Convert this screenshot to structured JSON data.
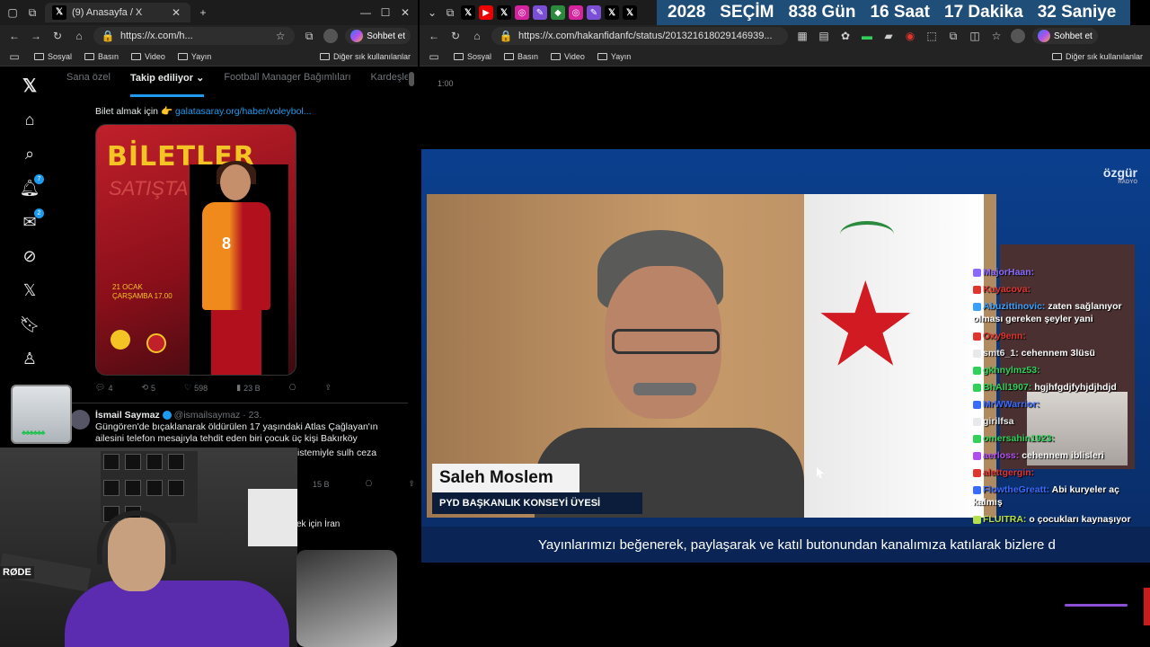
{
  "left_window": {
    "tab_title": "(9) Anasayfa / X",
    "url": "https://x.com/h...",
    "copilot_label": "Sohbet et",
    "bookmarks": [
      "Sosyal",
      "Basın",
      "Video",
      "Yayın"
    ],
    "bookmarks_right": "Diğer sık kullanılanlar"
  },
  "x_tabs": [
    "Sana özel",
    "Takip ediliyor",
    "Football Manager Bağımlıları",
    "Kardeşler Kı"
  ],
  "x_badges": {
    "notifications": "7",
    "messages": "2"
  },
  "tweet1": {
    "text_prefix": "Bilet almak için 👉",
    "link": "galatasaray.org/haber/voleybol...",
    "poster_title": "BİLETLER",
    "poster_subtitle": "SATIŞTA",
    "poster_date": "21 OCAK ÇARŞAMBA 17.00",
    "poster_number": "8",
    "replies": "4",
    "reposts": "5",
    "likes": "598",
    "views": "23 B"
  },
  "tweet2": {
    "name": "İsmail Saymaz",
    "handle": "@ismailsaymaz · 23.",
    "text": "Güngören'de bıçaklanarak öldürülen 17 yaşındaki Atlas Çağlayan'ın ailesini telefon mesajıyla tehdit eden biri çocuk üç kişi Bakırköy",
    "text_tail": "istemiyle sulh ceza",
    "views": "15 B"
  },
  "tweet3_fragment": "ek için İran",
  "webcam_brand": "RØDE",
  "right_window": {
    "url": "https://x.com/hakanfidanfc/status/2013216180291469​39...",
    "copilot_label": "Sohbet et",
    "bookmarks": [
      "Sosyal",
      "Basın",
      "Video",
      "Yayın"
    ],
    "bookmarks_right": "Diğer sık kullanılanlar"
  },
  "countdown": {
    "year": "2028",
    "label": "SEÇİM",
    "days": "838 Gün",
    "hours": "16 Saat",
    "minutes": "17 Dakika",
    "seconds": "32 Saniye"
  },
  "video": {
    "time": "1:00",
    "channel_logo": "özgür",
    "channel_sub": "RADYO",
    "lower_name": "Saleh Moslem",
    "lower_title": "PYD BAŞKANLIK KONSEYİ ÜYESİ",
    "ticker": "Yayınlarımızı beğenerek, paylaşarak ve katıl butonundan kanalımıza katılarak bizlere d"
  },
  "chat": [
    {
      "user": "MajorHaan:",
      "msg": "",
      "color": "#8a6bff"
    },
    {
      "user": "Kuyacova:",
      "msg": "",
      "color": "#e0342f"
    },
    {
      "user": "Abuzittinovic:",
      "msg": "zaten sağlanıyor olması gereken şeyler yani",
      "color": "#3aa0ff"
    },
    {
      "user": "Oxy9enn:",
      "msg": "",
      "color": "#e0342f"
    },
    {
      "user": "smt6_1:",
      "msg": "cehennem 3lüsü",
      "color": "#e7e9ea"
    },
    {
      "user": "gkhnylmz53:",
      "msg": "",
      "color": "#2fd15a"
    },
    {
      "user": "BhAll1907:",
      "msg": "hgjhfgdjfyhjdjhdjd",
      "color": "#2fd15a"
    },
    {
      "user": "MrWWarrior:",
      "msg": "",
      "color": "#3a6bff"
    },
    {
      "user": "girilfsa",
      "msg": "",
      "color": "#e7e9ea"
    },
    {
      "user": "omersahin1923:",
      "msg": "",
      "color": "#2fd15a"
    },
    {
      "user": "aerloss:",
      "msg": "cehennem iblisleri",
      "color": "#b04ff0"
    },
    {
      "user": "alettgergin:",
      "msg": "",
      "color": "#e0342f"
    },
    {
      "user": "FlowtheGreatt:",
      "msg": "Abi kuryeler aç kalmış",
      "color": "#3a6bff"
    },
    {
      "user": "FLUITRA:",
      "msg": "o çocukları kaynaşıyor",
      "color": "#b7e04f"
    }
  ]
}
